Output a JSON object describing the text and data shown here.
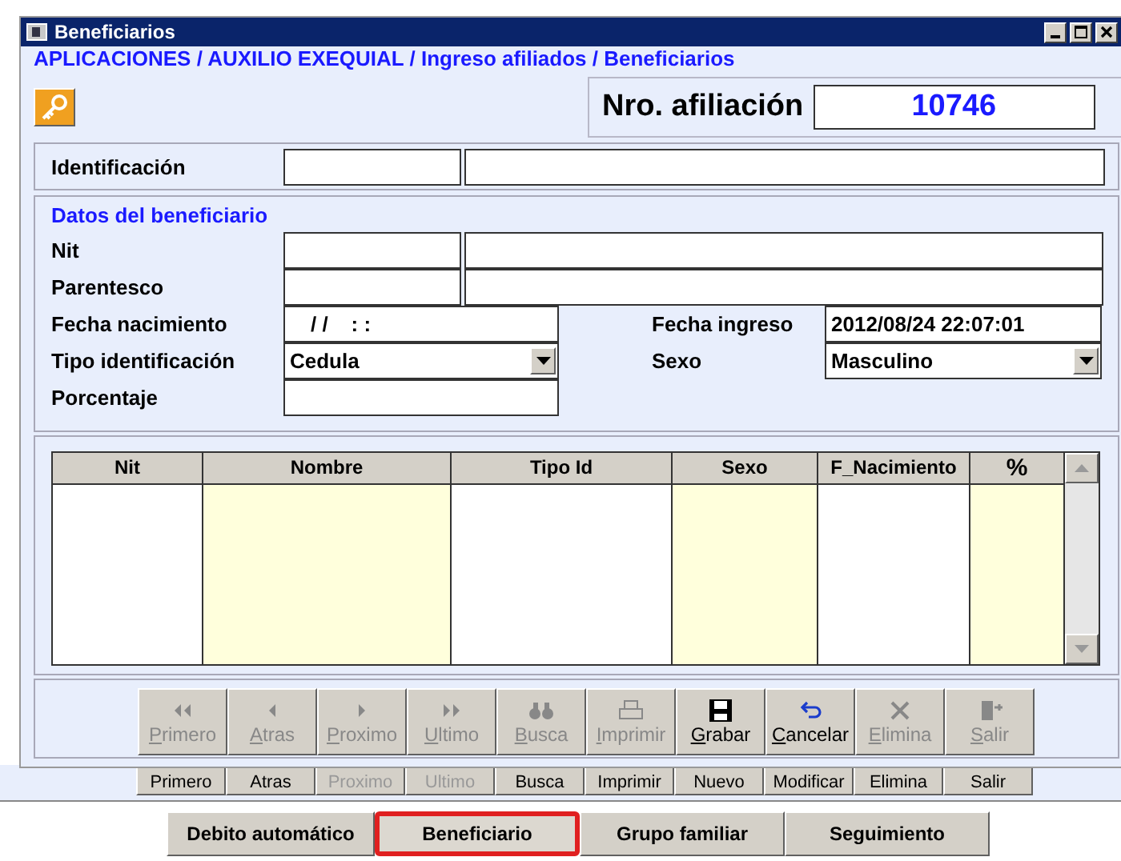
{
  "window": {
    "title": "Beneficiarios"
  },
  "breadcrumb": "APLICACIONES / AUXILIO EXEQUIAL / Ingreso afiliados / Beneficiarios",
  "affiliation": {
    "label": "Nro. afiliación",
    "value": "10746"
  },
  "identification": {
    "label": "Identificación"
  },
  "beneficiary": {
    "title": "Datos del beneficiario",
    "nit": {
      "label": "Nit"
    },
    "relationship": {
      "label": "Parentesco"
    },
    "birth_date": {
      "label": "Fecha nacimiento",
      "value": "/ /    : :"
    },
    "entry_date": {
      "label": "Fecha ingreso",
      "value": "2012/08/24 22:07:01"
    },
    "id_type": {
      "label": "Tipo identificación",
      "value": "Cedula"
    },
    "sex": {
      "label": "Sexo",
      "value": "Masculino"
    },
    "percentage": {
      "label": "Porcentaje"
    }
  },
  "table": {
    "columns": [
      "Nit",
      "Nombre",
      "Tipo Id",
      "Sexo",
      "F_Nacimiento",
      "%"
    ]
  },
  "toolbar": [
    {
      "label": "Primero",
      "kind": "first",
      "disabled": true
    },
    {
      "label": "Atras",
      "kind": "prev",
      "disabled": true
    },
    {
      "label": "Proximo",
      "kind": "next",
      "disabled": true
    },
    {
      "label": "Ultimo",
      "kind": "last",
      "disabled": true
    },
    {
      "label": "Busca",
      "kind": "search",
      "disabled": true
    },
    {
      "label": "Imprimir",
      "kind": "print",
      "disabled": true
    },
    {
      "label": "Grabar",
      "kind": "save",
      "disabled": false
    },
    {
      "label": "Cancelar",
      "kind": "undo",
      "disabled": false
    },
    {
      "label": "Elimina",
      "kind": "delete",
      "disabled": true
    },
    {
      "label": "Salir",
      "kind": "exit",
      "disabled": true
    }
  ],
  "back_toolbar": [
    {
      "label": "Primero",
      "disabled": false
    },
    {
      "label": "Atras",
      "disabled": false
    },
    {
      "label": "Proximo",
      "disabled": true
    },
    {
      "label": "Ultimo",
      "disabled": true
    },
    {
      "label": "Busca",
      "disabled": false
    },
    {
      "label": "Imprimir",
      "disabled": false
    },
    {
      "label": "Nuevo",
      "disabled": false
    },
    {
      "label": "Modificar",
      "disabled": false
    },
    {
      "label": "Elimina",
      "disabled": false
    },
    {
      "label": "Salir",
      "disabled": false
    }
  ],
  "tabs": [
    {
      "label": "Debito automático",
      "selected": false
    },
    {
      "label": "Beneficiario",
      "selected": true
    },
    {
      "label": "Grupo familiar",
      "selected": false
    },
    {
      "label": "Seguimiento",
      "selected": false
    }
  ]
}
